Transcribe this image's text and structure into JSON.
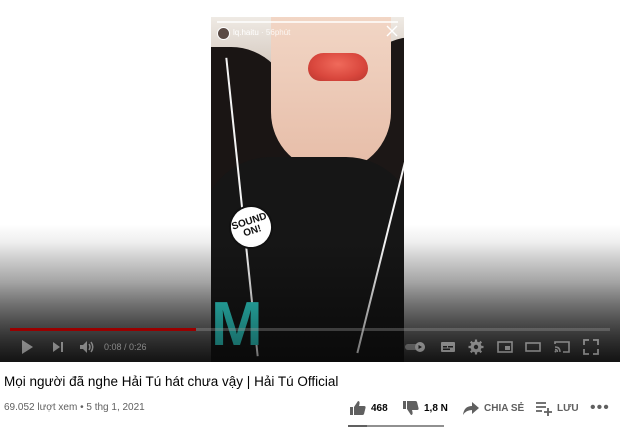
{
  "story": {
    "username": "lq.haitu",
    "time_ago": "56phút",
    "sticker_text": "SOUND ON!"
  },
  "player": {
    "time_current": "0:08",
    "time_total": "0:26",
    "time_separator": " / ",
    "progress_fraction": 0.31
  },
  "video": {
    "title": "Mọi người đã nghe Hải Tú hát chưa vậy | Hải Tú Official",
    "views": "69.052 lượt xem",
    "date_separator": " • ",
    "date": "5 thg 1, 2021"
  },
  "actions": {
    "likes": "468",
    "dislikes": "1,8 N",
    "share_label": "CHIA SẺ",
    "save_label": "LƯU",
    "like_ratio": 0.2
  },
  "colors": {
    "progress_red": "#ff0000",
    "text_primary": "#030303",
    "text_secondary": "#606060"
  },
  "icons": [
    "play-icon",
    "next-icon",
    "volume-icon",
    "autoplay-toggle",
    "subtitles-icon",
    "settings-icon",
    "miniplayer-icon",
    "theater-icon",
    "cast-icon",
    "fullscreen-icon",
    "thumbs-up-icon",
    "thumbs-down-icon",
    "share-icon",
    "add-to-playlist-icon",
    "more-icon"
  ]
}
